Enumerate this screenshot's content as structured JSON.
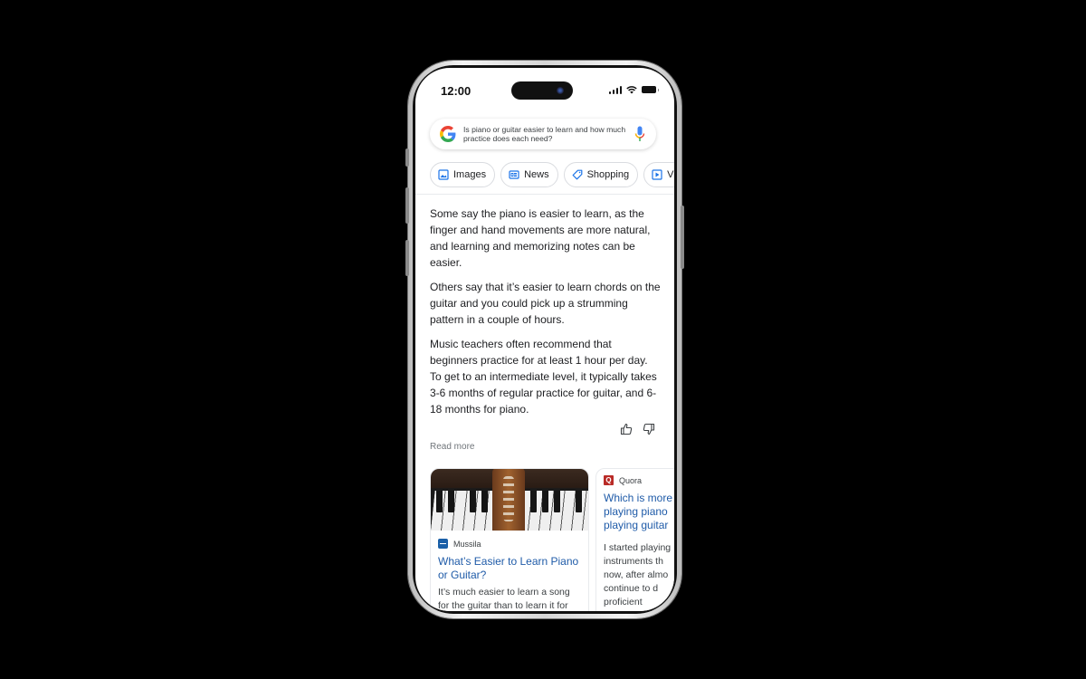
{
  "status_bar": {
    "time": "12:00",
    "icons": [
      "cellular-signal-icon",
      "wifi-icon",
      "battery-icon"
    ]
  },
  "search": {
    "query": "Is piano or guitar easier to learn and how much practice does each need?",
    "logo": "google-g-icon",
    "voice_icon": "microphone-icon"
  },
  "chips": [
    {
      "label": "Images",
      "icon": "image-icon"
    },
    {
      "label": "News",
      "icon": "news-icon"
    },
    {
      "label": "Shopping",
      "icon": "tag-icon"
    },
    {
      "label": "Videos",
      "icon": "play-icon"
    }
  ],
  "answer": {
    "paragraphs": [
      "Some say the piano is easier to learn, as the finger and hand movements are more natural, and learning and memorizing notes can be easier.",
      "Others say that it’s easier to learn chords on the guitar and you could pick up a strumming pattern in a couple of hours.",
      "Music teachers often recommend that beginners practice for at least 1 hour per day. To get to an intermediate level, it typically takes 3-6 months of regular practice for guitar, and 6-18 months for piano."
    ],
    "feedback": {
      "positive": "thumbs-up-icon",
      "negative": "thumbs-down-icon"
    },
    "read_more": "Read more"
  },
  "cards": [
    {
      "source": "Mussila",
      "title": "What’s Easier to Learn Piano or Guitar?",
      "snippet_lines": [
        "It’s much easier to learn a song",
        "for the guitar than to learn it for"
      ]
    },
    {
      "source": "Quora",
      "source_badge": "Q",
      "title_lines": [
        "Which is more",
        "playing piano",
        "playing guitar"
      ],
      "snippet_lines": [
        "I started playing",
        "instruments th",
        "now, after almo",
        "continue to d",
        "proficient"
      ]
    }
  ],
  "colors": {
    "link": "#1f5ba8",
    "quora": "#b92b27",
    "mussila": "#1a5fa8"
  }
}
